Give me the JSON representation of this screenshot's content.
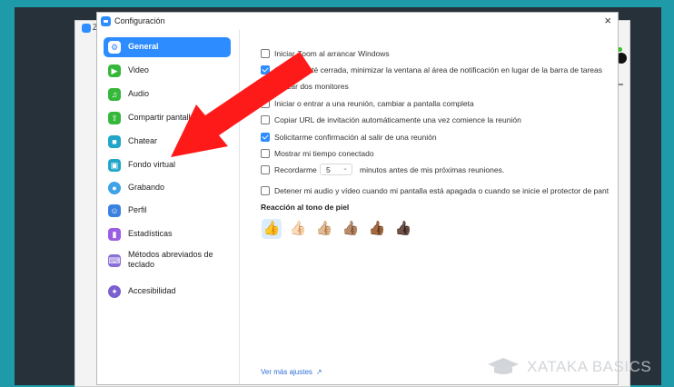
{
  "dialog": {
    "title": "Configuración",
    "close": "×"
  },
  "background_app": {
    "partial_title": "Z"
  },
  "sidebar": {
    "items": [
      {
        "label": "General",
        "icon": "gear-icon",
        "color": "#2d8cff",
        "glyph": "⚙"
      },
      {
        "label": "Video",
        "icon": "video-camera-icon",
        "color": "#35b83a",
        "glyph": "▶"
      },
      {
        "label": "Audio",
        "icon": "headphones-icon",
        "color": "#35b83a",
        "glyph": "♫"
      },
      {
        "label": "Compartir pantalla",
        "icon": "share-screen-icon",
        "color": "#35b83a",
        "glyph": "⇧"
      },
      {
        "label": "Chatear",
        "icon": "chat-bubble-icon",
        "color": "#20a6c7",
        "glyph": "■"
      },
      {
        "label": "Fondo virtual",
        "icon": "virtual-background-icon",
        "color": "#20a6c7",
        "glyph": "▣"
      },
      {
        "label": "Grabando",
        "icon": "record-icon",
        "color": "#3ea2e8",
        "glyph": "●"
      },
      {
        "label": "Perfil",
        "icon": "profile-icon",
        "color": "#3b82e0",
        "glyph": "☺"
      },
      {
        "label": "Estadísticas",
        "icon": "statistics-icon",
        "color": "#9b5de5",
        "glyph": "▮"
      },
      {
        "label": "Métodos abreviados de teclado",
        "icon": "keyboard-icon",
        "color": "#8a6fd6",
        "glyph": "⌨"
      },
      {
        "label": "Accesibilidad",
        "icon": "accessibility-icon",
        "color": "#7b5fd0",
        "glyph": "✦"
      }
    ]
  },
  "general": {
    "options": [
      {
        "label": "Iniciar Zoom al arrancar Windows",
        "checked": false
      },
      {
        "label": "Cuando esté cerrada, minimizar la ventana al área de notificación en lugar de la barra de tareas",
        "checked": true
      },
      {
        "label": "Utilizar dos monitores",
        "checked": false
      },
      {
        "label": "Iniciar o entrar a una reunión, cambiar a pantalla completa",
        "checked": false
      },
      {
        "label": "Copiar URL de invitación automáticamente una vez comience la reunión",
        "checked": false
      },
      {
        "label": "Solicitarme confirmación al salir de una reunión",
        "checked": true
      },
      {
        "label": "Mostrar mi tiempo conectado",
        "checked": false
      }
    ],
    "reminder": {
      "label": "Recordarme",
      "value": "5",
      "after": "minutos antes de mis próximas reuniones.",
      "checked": false
    },
    "stop_av": {
      "label": "Detener mi audio y vídeo cuando mi pantalla está apagada o cuando se inicie el protector de pant",
      "checked": false
    },
    "skin_tone": {
      "title": "Reacción al tono de piel",
      "tones": [
        "👍",
        "👍🏻",
        "👍🏼",
        "👍🏽",
        "👍🏾",
        "👍🏿"
      ],
      "selected": 0
    },
    "more_settings": "Ver más ajustes"
  },
  "watermark": {
    "text": "XATAKA BASICS"
  },
  "colors": {
    "accent": "#2d8cff",
    "arrow": "#ff1a1a",
    "page_bg": "#1e9aa8"
  }
}
